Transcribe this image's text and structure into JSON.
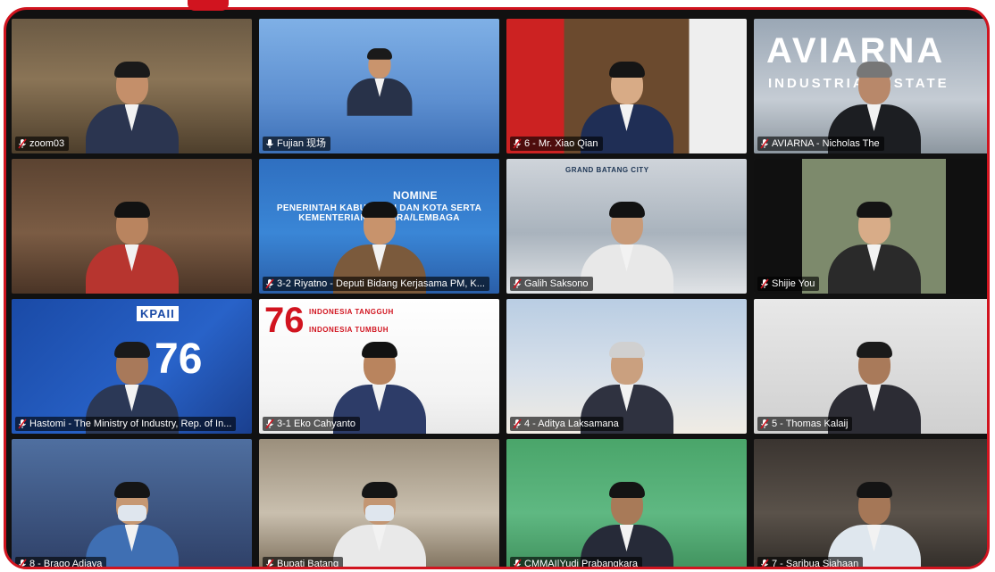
{
  "meeting": {
    "accent_color": "#d1141f",
    "speaking_color": "#4fae3a",
    "participants": [
      {
        "name": "zoom03",
        "muted": true,
        "speaking": false
      },
      {
        "name": "Fujian 现场",
        "muted": false,
        "speaking": true
      },
      {
        "name": "6 - Mr. Xiao Qian",
        "muted": true,
        "speaking": false
      },
      {
        "name": "AVIARNA - Nicholas The",
        "muted": true,
        "speaking": false
      },
      {
        "name": "",
        "muted": false,
        "speaking": false
      },
      {
        "name": "3-2 Riyatno - Deputi Bidang Kerjasama PM, K...",
        "muted": true,
        "speaking": false
      },
      {
        "name": "Galih Saksono",
        "muted": true,
        "speaking": false
      },
      {
        "name": "Shijie You",
        "muted": true,
        "speaking": false
      },
      {
        "name": "Hastomi - The Ministry of Industry, Rep. of In...",
        "muted": true,
        "speaking": false
      },
      {
        "name": "3-1 Eko Cahyanto",
        "muted": true,
        "speaking": false
      },
      {
        "name": "4 - Aditya Laksamana",
        "muted": true,
        "speaking": false
      },
      {
        "name": "5 - Thomas Kalaij",
        "muted": true,
        "speaking": false
      },
      {
        "name": "8 - Brago Adjaya",
        "muted": true,
        "speaking": false
      },
      {
        "name": "Bupati Batang",
        "muted": true,
        "speaking": false
      },
      {
        "name": "CMMAI|Yudi Prabangkara",
        "muted": true,
        "speaking": false
      },
      {
        "name": "7 - Saribua Siahaan",
        "muted": true,
        "speaking": false
      }
    ]
  },
  "backgrounds": {
    "aviarna_brand": "AVIARNA",
    "aviarna_sub": "INDUSTRIAL ESTATE",
    "slide_title": "PENERINTAH KABUPATEN DAN KOTA SERTA KEMENTERIAN NEGARA/LEMBAGA",
    "slide_heading": "NOMINE",
    "kpaii_logo": "KPAII",
    "anniv_number": "76",
    "anniv_tagline_1": "INDONESIA TANGGUH",
    "anniv_tagline_2": "INDONESIA TUMBUH",
    "grand_city": "GRAND BATANG CITY"
  }
}
